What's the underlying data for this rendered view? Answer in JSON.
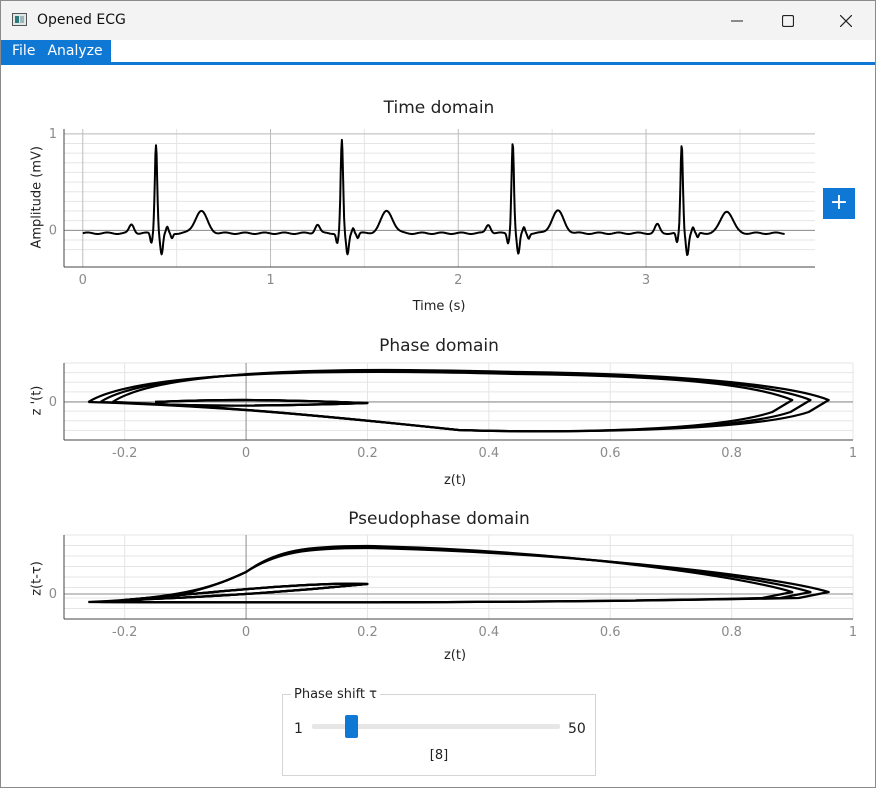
{
  "window": {
    "title": "Opened ECG"
  },
  "menu": {
    "items": [
      "File",
      "Analyze"
    ]
  },
  "plots": {
    "time": {
      "title": "Time domain",
      "xlabel": "Time (s)",
      "ylabel": "Amplitude (mV)",
      "xticks": [
        "0",
        "1",
        "2",
        "3"
      ],
      "yticks": [
        "1",
        "0"
      ]
    },
    "phase": {
      "title": "Phase domain",
      "xlabel": "z(t)",
      "ylabel": "z '(t)",
      "xticks": [
        "-0.2",
        "0",
        "0.2",
        "0.4",
        "0.6",
        "0.8",
        "1"
      ],
      "yticks": [
        "0"
      ]
    },
    "pseudo": {
      "title": "Pseudophase domain",
      "xlabel": "z(t)",
      "ylabel": "z(t-τ)",
      "xticks": [
        "-0.2",
        "0",
        "0.2",
        "0.4",
        "0.6",
        "0.8",
        "1"
      ],
      "yticks": [
        "0"
      ]
    }
  },
  "add_button": {
    "label": "+"
  },
  "phase_shift": {
    "label": "Phase shift τ",
    "min": "1",
    "max": "50",
    "value": 8,
    "value_text": "[8]"
  },
  "colors": {
    "accent": "#0f78d4",
    "line": "#000000",
    "grid": "#e5e5e5"
  },
  "chart_data": [
    {
      "type": "line",
      "title": "Time domain",
      "xlabel": "Time (s)",
      "ylabel": "Amplitude (mV)",
      "xlim": [
        -0.1,
        3.9
      ],
      "ylim": [
        -0.38,
        1.05
      ],
      "beats_r_peak_time": [
        0.39,
        1.38,
        2.29,
        3.19
      ],
      "r_peak_amplitude": [
        0.92,
        0.96,
        0.94,
        0.91
      ],
      "t_wave_amplitude": 0.2,
      "baseline": -0.03,
      "x_end": 3.74
    },
    {
      "type": "line",
      "title": "Phase domain",
      "xlabel": "z(t)",
      "ylabel": "z '(t)",
      "xlim": [
        -0.3,
        1.0
      ],
      "loops": [
        {
          "x_min": -0.26,
          "x_max": 0.9,
          "y_top": 0.38,
          "y_bottom": -0.37
        },
        {
          "x_min": -0.24,
          "x_max": 0.93,
          "y_top": 0.36,
          "y_bottom": -0.38
        },
        {
          "x_min": -0.22,
          "x_max": 0.96,
          "y_top": 0.37,
          "y_bottom": -0.38
        }
      ]
    },
    {
      "type": "line",
      "title": "Pseudophase domain",
      "xlabel": "z(t)",
      "ylabel": "z(t-τ)",
      "xlim": [
        -0.3,
        1.0
      ],
      "loops": [
        {
          "x_min": -0.26,
          "x_max": 0.9
        },
        {
          "x_min": -0.24,
          "x_max": 0.93
        },
        {
          "x_min": -0.22,
          "x_max": 0.96
        }
      ]
    }
  ]
}
